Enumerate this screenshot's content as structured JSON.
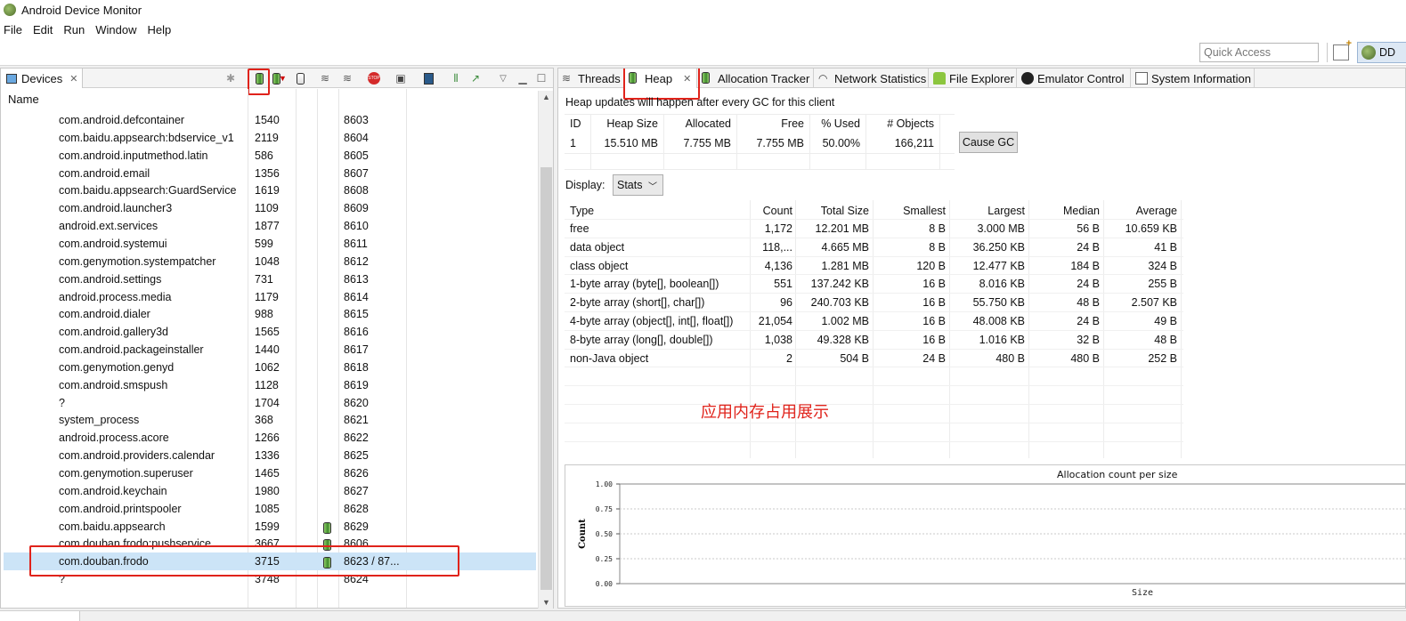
{
  "window": {
    "title": "Android Device Monitor"
  },
  "menu": [
    "File",
    "Edit",
    "Run",
    "Window",
    "Help"
  ],
  "toolbar": {
    "quick_access_placeholder": "Quick Access",
    "perspective_label": "DD"
  },
  "devices_panel": {
    "tab_label": "Devices",
    "column_name": "Name",
    "rows": [
      {
        "name": "com.android.defcontainer",
        "pid": "1540",
        "port": "8603",
        "heap": false
      },
      {
        "name": "com.baidu.appsearch:bdservice_v1",
        "pid": "2119",
        "port": "8604",
        "heap": false
      },
      {
        "name": "com.android.inputmethod.latin",
        "pid": "586",
        "port": "8605",
        "heap": false
      },
      {
        "name": "com.android.email",
        "pid": "1356",
        "port": "8607",
        "heap": false
      },
      {
        "name": "com.baidu.appsearch:GuardService",
        "pid": "1619",
        "port": "8608",
        "heap": false
      },
      {
        "name": "com.android.launcher3",
        "pid": "1109",
        "port": "8609",
        "heap": false
      },
      {
        "name": "android.ext.services",
        "pid": "1877",
        "port": "8610",
        "heap": false
      },
      {
        "name": "com.android.systemui",
        "pid": "599",
        "port": "8611",
        "heap": false
      },
      {
        "name": "com.genymotion.systempatcher",
        "pid": "1048",
        "port": "8612",
        "heap": false
      },
      {
        "name": "com.android.settings",
        "pid": "731",
        "port": "8613",
        "heap": false
      },
      {
        "name": "android.process.media",
        "pid": "1179",
        "port": "8614",
        "heap": false
      },
      {
        "name": "com.android.dialer",
        "pid": "988",
        "port": "8615",
        "heap": false
      },
      {
        "name": "com.android.gallery3d",
        "pid": "1565",
        "port": "8616",
        "heap": false
      },
      {
        "name": "com.android.packageinstaller",
        "pid": "1440",
        "port": "8617",
        "heap": false
      },
      {
        "name": "com.genymotion.genyd",
        "pid": "1062",
        "port": "8618",
        "heap": false
      },
      {
        "name": "com.android.smspush",
        "pid": "1128",
        "port": "8619",
        "heap": false
      },
      {
        "name": "?",
        "pid": "1704",
        "port": "8620",
        "heap": false
      },
      {
        "name": "system_process",
        "pid": "368",
        "port": "8621",
        "heap": false
      },
      {
        "name": "android.process.acore",
        "pid": "1266",
        "port": "8622",
        "heap": false
      },
      {
        "name": "com.android.providers.calendar",
        "pid": "1336",
        "port": "8625",
        "heap": false
      },
      {
        "name": "com.genymotion.superuser",
        "pid": "1465",
        "port": "8626",
        "heap": false
      },
      {
        "name": "com.android.keychain",
        "pid": "1980",
        "port": "8627",
        "heap": false
      },
      {
        "name": "com.android.printspooler",
        "pid": "1085",
        "port": "8628",
        "heap": false
      },
      {
        "name": "com.baidu.appsearch",
        "pid": "1599",
        "port": "8629",
        "heap": true
      },
      {
        "name": "com.douban.frodo:pushservice",
        "pid": "3667",
        "port": "8606",
        "heap": true
      },
      {
        "name": "com.douban.frodo",
        "pid": "3715",
        "port": "8623 / 87...",
        "heap": true,
        "selected": true
      },
      {
        "name": "?",
        "pid": "3748",
        "port": "8624",
        "heap": false
      }
    ]
  },
  "tabs": [
    {
      "label": "Threads"
    },
    {
      "label": "Heap",
      "active": true
    },
    {
      "label": "Allocation Tracker"
    },
    {
      "label": "Network Statistics"
    },
    {
      "label": "File Explorer"
    },
    {
      "label": "Emulator Control"
    },
    {
      "label": "System Information"
    }
  ],
  "heap": {
    "note": "Heap updates will happen after every GC for this client",
    "summary_headers": [
      "ID",
      "Heap Size",
      "Allocated",
      "Free",
      "% Used",
      "# Objects"
    ],
    "summary_row": [
      "1",
      "15.510 MB",
      "7.755 MB",
      "7.755 MB",
      "50.00%",
      "166,211"
    ],
    "cause_gc_label": "Cause GC",
    "display_label": "Display:",
    "display_value": "Stats",
    "stats_headers": [
      "Type",
      "Count",
      "Total Size",
      "Smallest",
      "Largest",
      "Median",
      "Average"
    ],
    "stats_rows": [
      [
        "free",
        "1,172",
        "12.201 MB",
        "8 B",
        "3.000 MB",
        "56 B",
        "10.659 KB"
      ],
      [
        "data object",
        "118,...",
        "4.665 MB",
        "8 B",
        "36.250 KB",
        "24 B",
        "41 B"
      ],
      [
        "class object",
        "4,136",
        "1.281 MB",
        "120 B",
        "12.477 KB",
        "184 B",
        "324 B"
      ],
      [
        "1-byte array (byte[], boolean[])",
        "551",
        "137.242 KB",
        "16 B",
        "8.016 KB",
        "24 B",
        "255 B"
      ],
      [
        "2-byte array (short[], char[])",
        "96",
        "240.703 KB",
        "16 B",
        "55.750 KB",
        "48 B",
        "2.507 KB"
      ],
      [
        "4-byte array (object[], int[], float[])",
        "21,054",
        "1.002 MB",
        "16 B",
        "48.008 KB",
        "24 B",
        "49 B"
      ],
      [
        "8-byte array (long[], double[])",
        "1,038",
        "49.328 KB",
        "16 B",
        "1.016 KB",
        "32 B",
        "48 B"
      ],
      [
        "non-Java object",
        "2",
        "504 B",
        "24 B",
        "480 B",
        "480 B",
        "252 B"
      ]
    ],
    "annotation": "应用内存占用展示"
  },
  "chart_data": {
    "type": "bar",
    "title": "Allocation count per size",
    "xlabel": "Size",
    "ylabel": "Count",
    "ylim": [
      0,
      1
    ],
    "y_ticks": [
      "0.00",
      "0.25",
      "0.50",
      "0.75",
      "1.00"
    ],
    "grid": true,
    "series": []
  },
  "colors": {
    "selection": "#cce4f7",
    "highlight": "#e0231b"
  }
}
